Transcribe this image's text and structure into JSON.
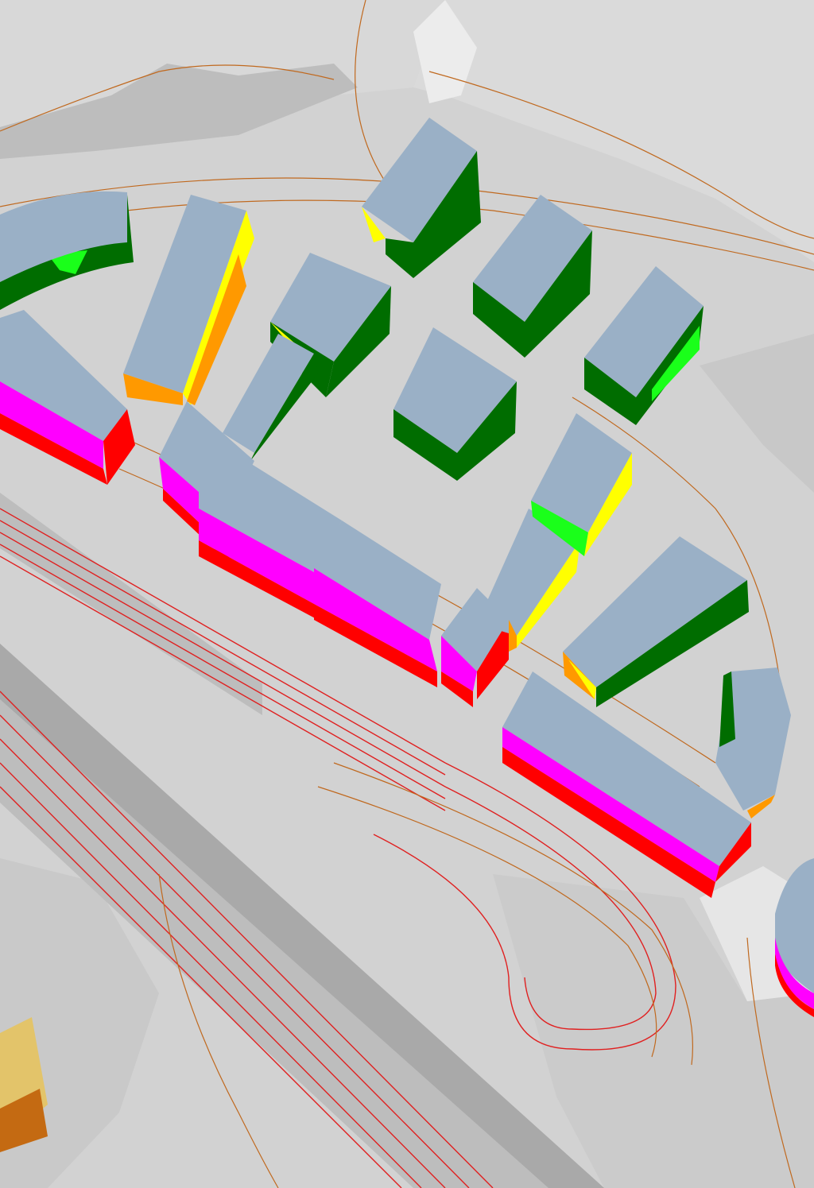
{
  "view": {
    "type": "3d-noise-facade-map",
    "labels": []
  },
  "colors": {
    "ground": "#d2d2d2",
    "ground_light": "#e4e4e4",
    "ground_dark": "#bdbdbd",
    "roof": "#9ab0c6",
    "contour": "#c0691f",
    "rail": "#e02020",
    "road_surface": "#c2c2c2",
    "road_dark": "#a9a9a9",
    "terrain_brown": "#c46a12",
    "terrain_yellow": "#e3c46a"
  },
  "noise_scale": [
    {
      "level": "very-low",
      "color": "#006d00"
    },
    {
      "level": "low",
      "color": "#1aff1a"
    },
    {
      "level": "medium",
      "color": "#ffff00"
    },
    {
      "level": "high",
      "color": "#ff9900"
    },
    {
      "level": "very-high",
      "color": "#ff0000"
    },
    {
      "level": "extreme",
      "color": "#ff00ff"
    }
  ]
}
